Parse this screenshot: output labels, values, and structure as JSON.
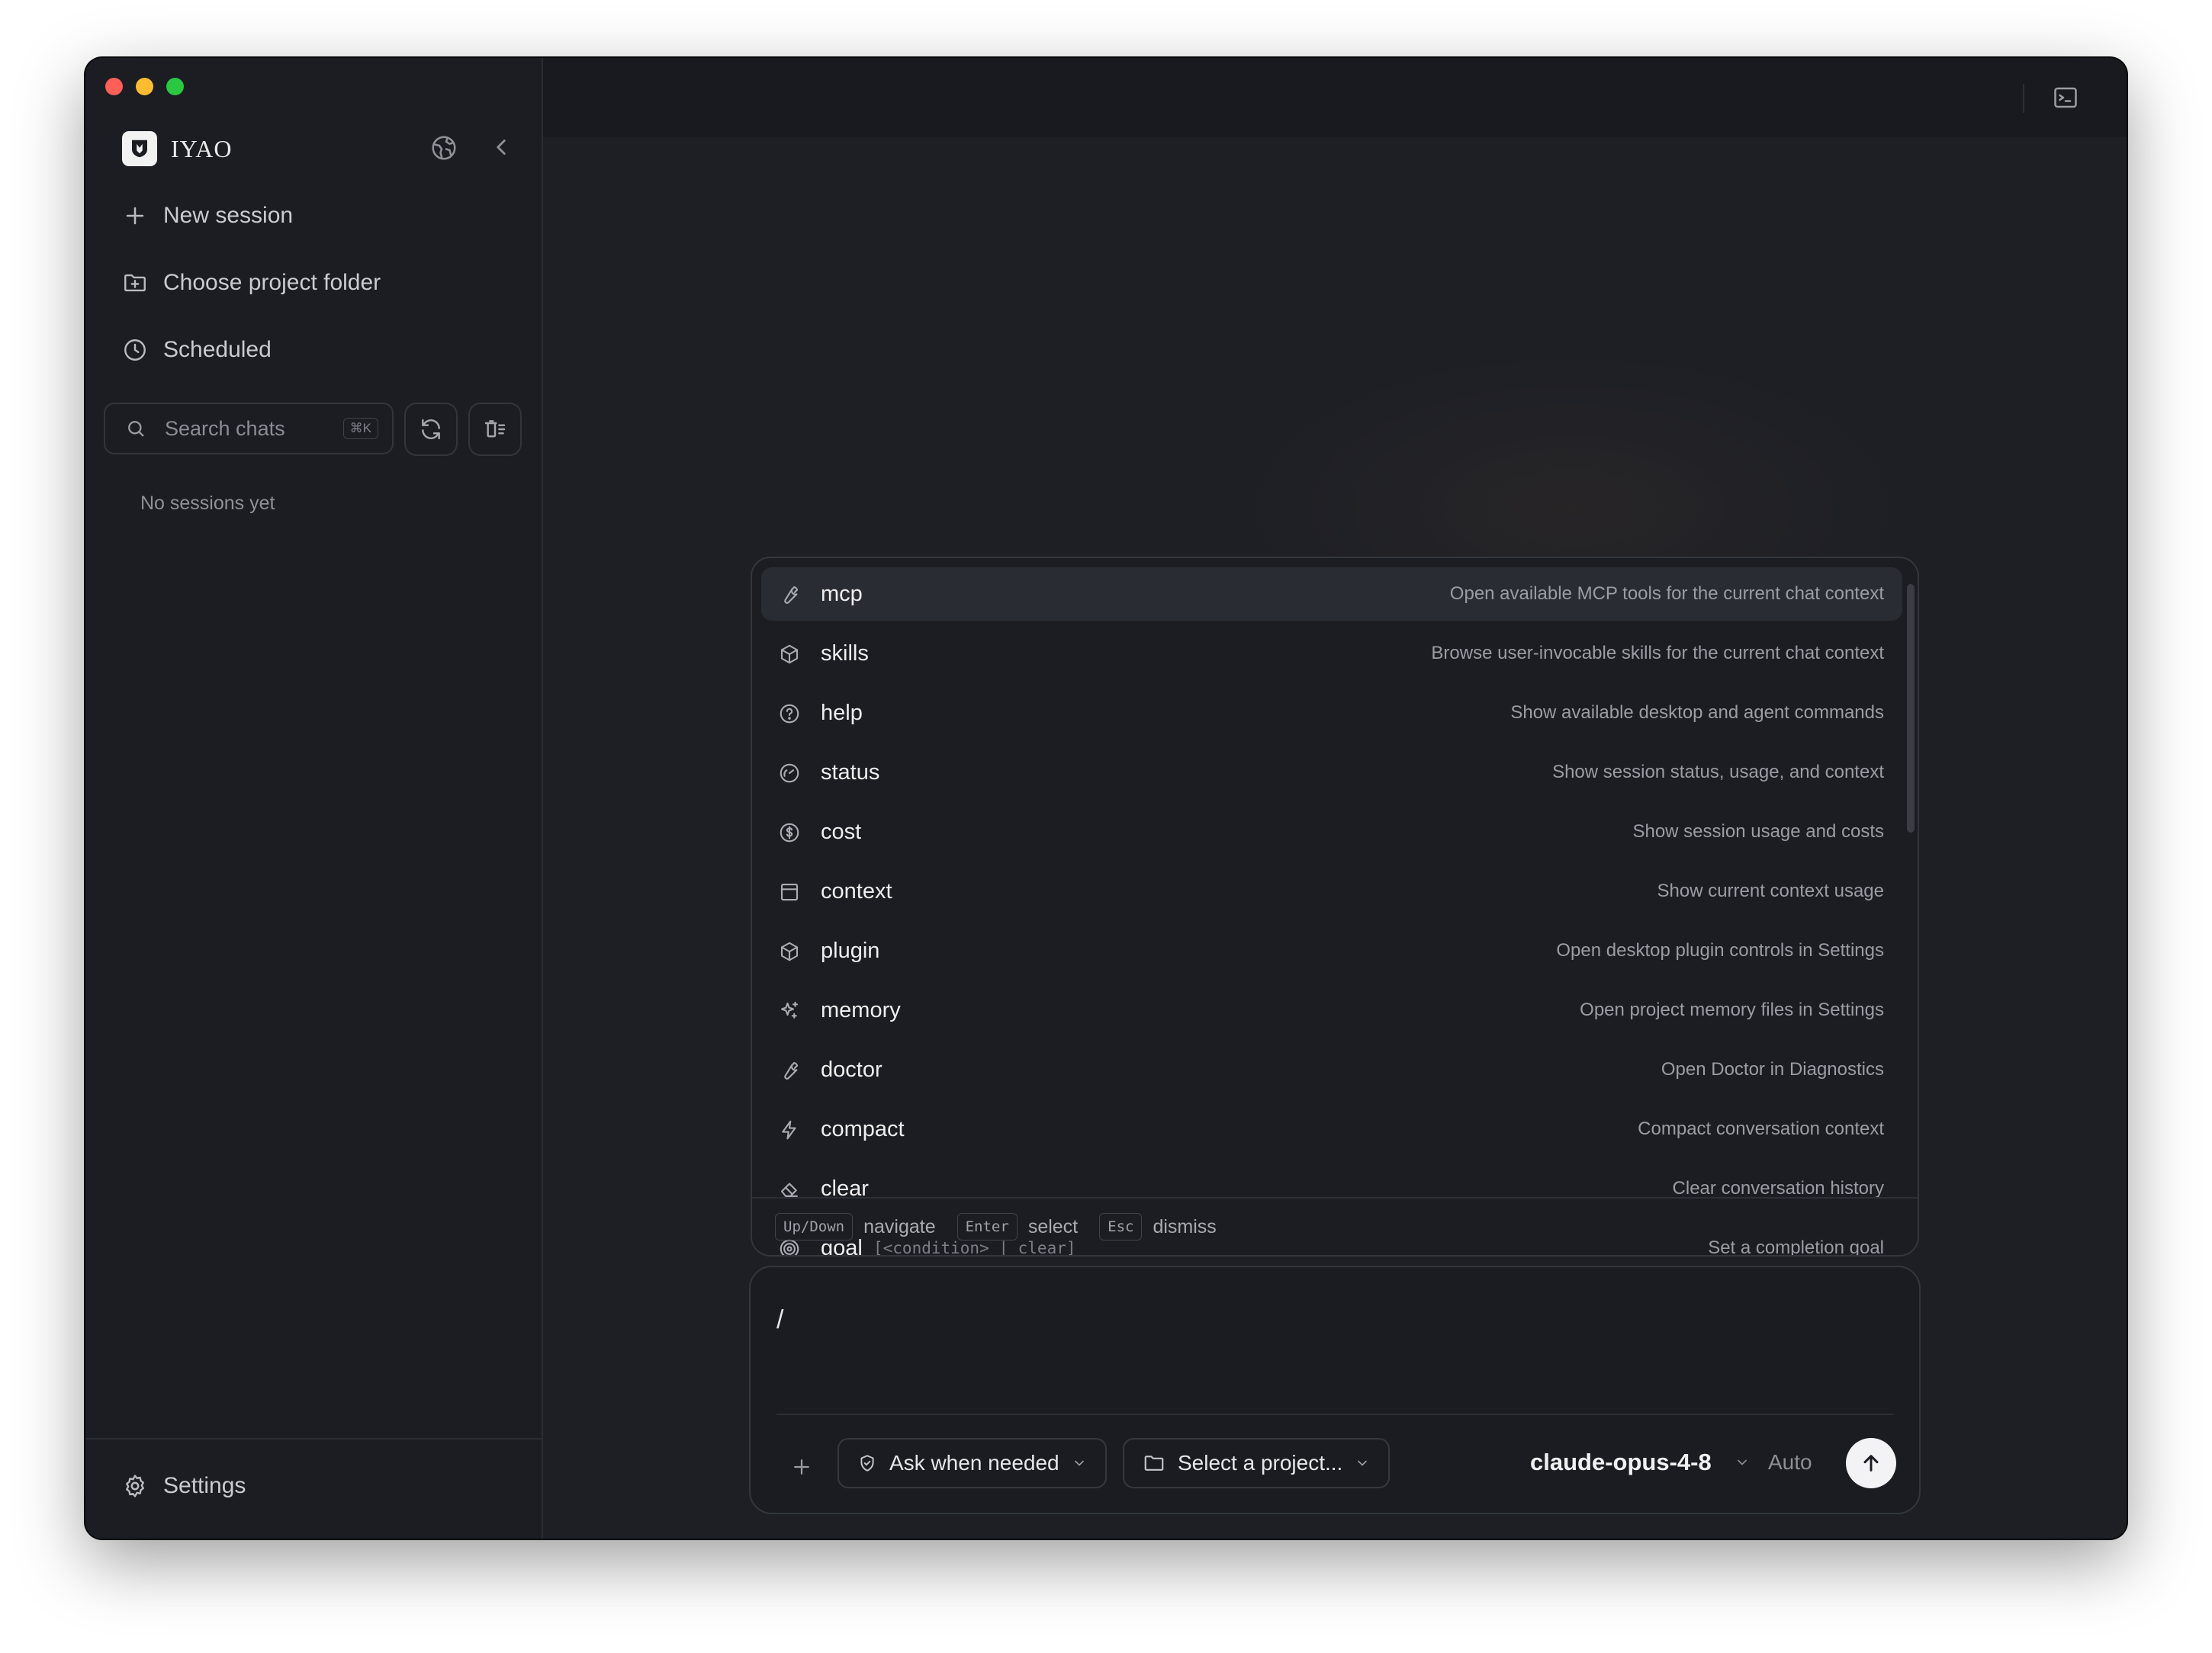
{
  "app": {
    "name": "IYAO"
  },
  "sidebar": {
    "new_session": "New session",
    "choose_folder": "Choose project folder",
    "scheduled": "Scheduled",
    "search": {
      "placeholder": "Search chats",
      "shortcut": "⌘K"
    },
    "empty_text": "No sessions yet",
    "settings": "Settings"
  },
  "palette": {
    "commands": [
      {
        "name": "mcp",
        "args": "",
        "description": "Open available MCP tools for the current chat context",
        "icon": "wrench-icon",
        "active": true
      },
      {
        "name": "skills",
        "args": "",
        "description": "Browse user-invocable skills for the current chat context",
        "icon": "package-icon"
      },
      {
        "name": "help",
        "args": "",
        "description": "Show available desktop and agent commands",
        "icon": "help-circle-icon"
      },
      {
        "name": "status",
        "args": "",
        "description": "Show session status, usage, and context",
        "icon": "gauge-icon"
      },
      {
        "name": "cost",
        "args": "",
        "description": "Show session usage and costs",
        "icon": "dollar-circle-icon"
      },
      {
        "name": "context",
        "args": "",
        "description": "Show current context usage",
        "icon": "panel-icon"
      },
      {
        "name": "plugin",
        "args": "",
        "description": "Open desktop plugin controls in Settings",
        "icon": "package-icon"
      },
      {
        "name": "memory",
        "args": "",
        "description": "Open project memory files in Settings",
        "icon": "sparkles-icon"
      },
      {
        "name": "doctor",
        "args": "",
        "description": "Open Doctor in Diagnostics",
        "icon": "wrench-icon"
      },
      {
        "name": "compact",
        "args": "",
        "description": "Compact conversation context",
        "icon": "zap-icon"
      },
      {
        "name": "clear",
        "args": "",
        "description": "Clear conversation history",
        "icon": "eraser-icon"
      },
      {
        "name": "goal",
        "args": "[<condition> | clear]",
        "description": "Set a completion goal",
        "icon": "target-icon"
      }
    ],
    "footer": {
      "navigate_key": "Up/Down",
      "navigate_label": "navigate",
      "select_key": "Enter",
      "select_label": "select",
      "dismiss_key": "Esc",
      "dismiss_label": "dismiss"
    }
  },
  "composer": {
    "input_value": "/",
    "permission": "Ask when needed",
    "project": "Select a project...",
    "model": "claude-opus-4-8",
    "mode": "Auto"
  },
  "colors": {
    "window_bg": "#17191e",
    "sidebar_bg": "#1b1d22",
    "palette_bg": "#1b1d22",
    "active_row": "#2a2c33",
    "text_primary": "#eeeef0",
    "text_muted": "#9a9da4"
  }
}
